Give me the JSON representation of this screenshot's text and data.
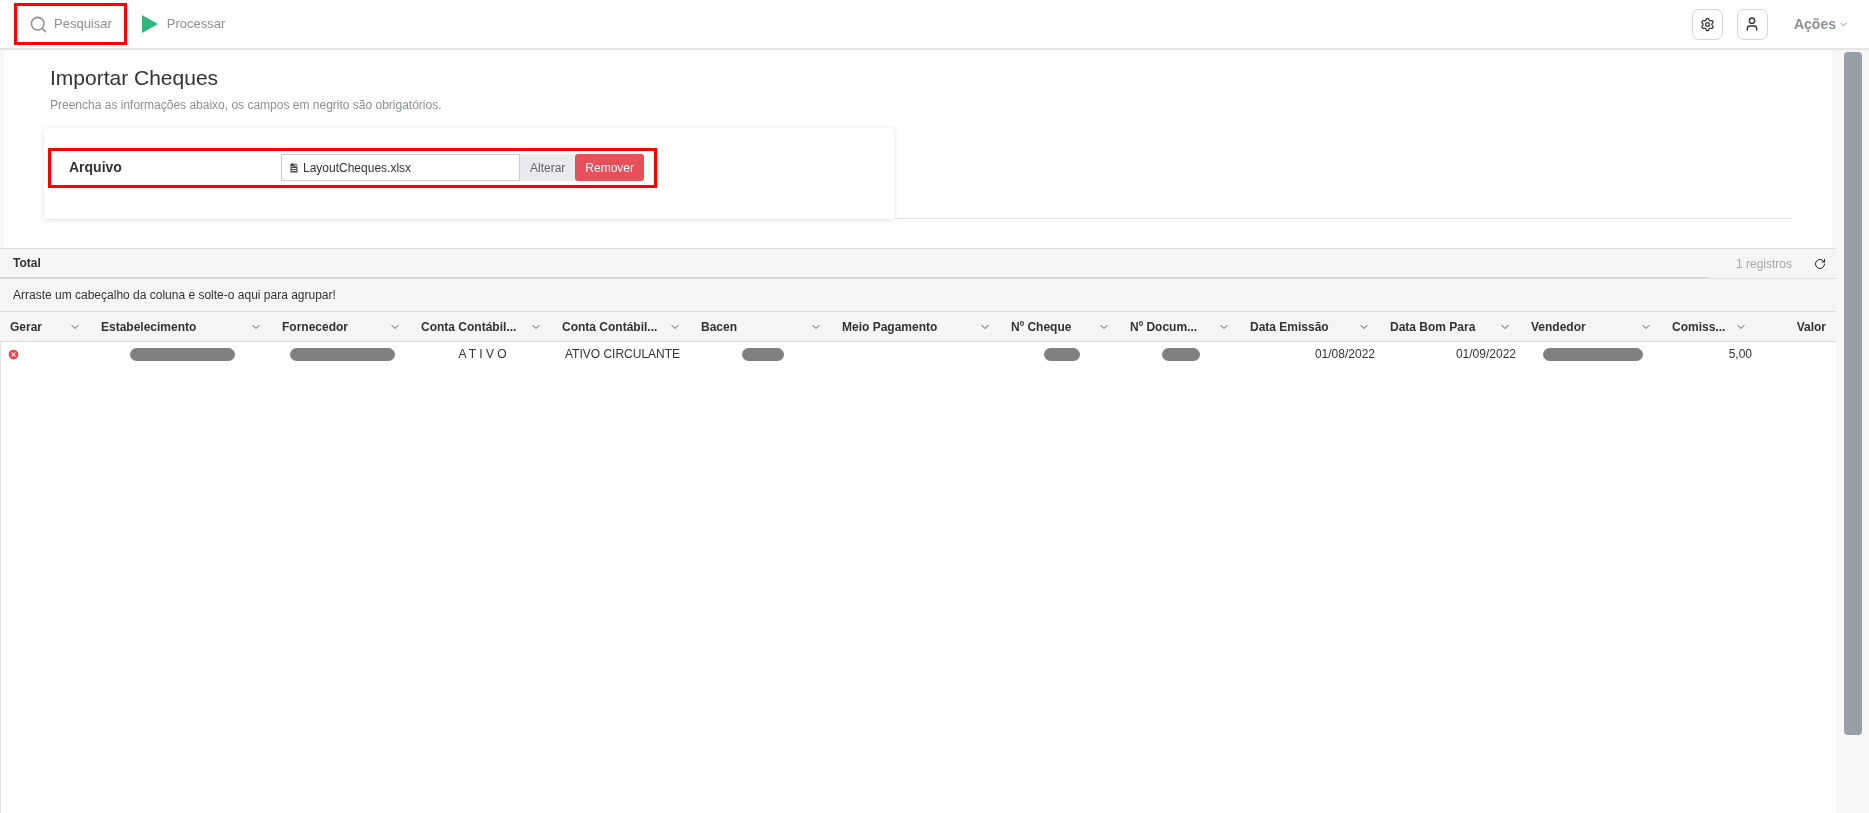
{
  "toolbar": {
    "search_button": {
      "label": "Pesquisar",
      "highlighted": true
    },
    "process_button": {
      "label": "Processar"
    },
    "actions_menu": {
      "label": "Ações"
    }
  },
  "page": {
    "title": "Importar Cheques",
    "subtitle": "Preencha as informações abaixo, os campos em negrito são obrigatórios."
  },
  "form": {
    "highlighted": true,
    "file_label": "Arquivo",
    "file_name": "LayoutCheques.xlsx",
    "change_button": "Alterar",
    "remove_button": "Remover"
  },
  "grid": {
    "total_label": "Total",
    "record_count": "1 registros",
    "group_hint": "Arraste um cabeçalho da coluna e solte-o aqui para agrupar!",
    "columns": [
      {
        "label": "Gerar"
      },
      {
        "label": "Estabelecimento"
      },
      {
        "label": "Fornecedor"
      },
      {
        "label": "Conta Contábil..."
      },
      {
        "label": "Conta Contábil..."
      },
      {
        "label": "Bacen"
      },
      {
        "label": "Meio Pagamento"
      },
      {
        "label": "Nº Cheque"
      },
      {
        "label": "Nº Docum..."
      },
      {
        "label": "Data Emissão"
      },
      {
        "label": "Data Bom Para"
      },
      {
        "label": "Vendedor"
      },
      {
        "label": "Comiss..."
      },
      {
        "label": "Valor"
      }
    ],
    "rows": [
      {
        "cells": [
          {
            "kind": "error"
          },
          {
            "kind": "redacted"
          },
          {
            "kind": "redacted"
          },
          {
            "kind": "text",
            "text": "A T I V O"
          },
          {
            "kind": "text",
            "text": "ATIVO CIRCULANTE"
          },
          {
            "kind": "redacted"
          },
          {
            "kind": "empty"
          },
          {
            "kind": "redacted"
          },
          {
            "kind": "redacted"
          },
          {
            "kind": "text",
            "text": "01/08/2022"
          },
          {
            "kind": "text",
            "text": "01/09/2022"
          },
          {
            "kind": "redacted"
          },
          {
            "kind": "text",
            "text": "5,00"
          },
          {
            "kind": "empty"
          }
        ]
      }
    ]
  }
}
